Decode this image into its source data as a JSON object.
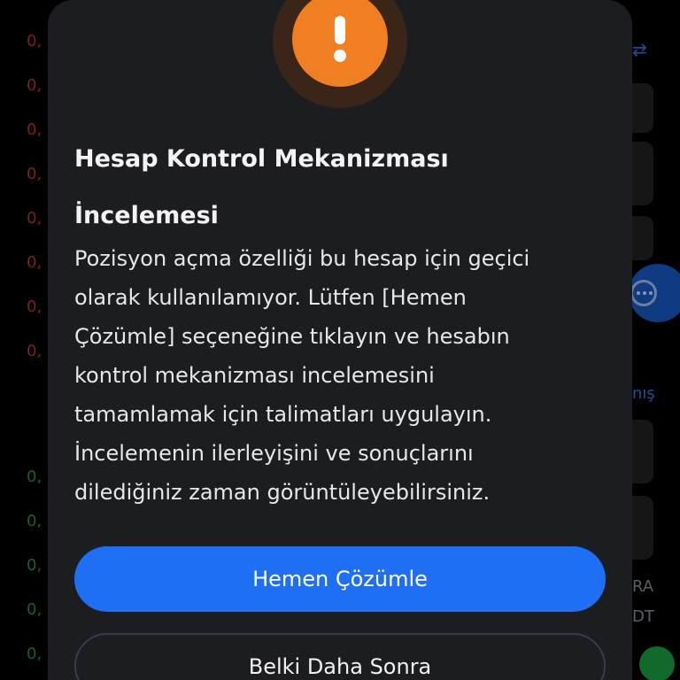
{
  "background": {
    "left_rows_red": [
      "0,",
      "0,",
      "0,",
      "0,",
      "0,",
      "0,",
      "0,",
      "0,"
    ],
    "left_rows_green": [
      "0,",
      "0,",
      "0,",
      "0,",
      "0,"
    ],
    "right_link": "nış",
    "right_text_1": "RA",
    "right_text_2": "DT",
    "colors": {
      "red": "#7a2020",
      "green": "#1c5c34"
    }
  },
  "modal": {
    "icon": "exclamation-icon",
    "icon_color": "#f07f24",
    "title_lines": [
      "Hesap Kontrol Mekanizması",
      "İncelemesi"
    ],
    "body_lines": [
      "Pozisyon açma özelliği bu hesap için geçici",
      "olarak kullanılamıyor. Lütfen [Hemen",
      "Çözümle] seçeneğine tıklayın ve hesabın",
      "kontrol mekanizması incelemesini",
      "tamamlamak için talimatları uygulayın.",
      "İncelemenin ilerleyişini ve sonuçlarını",
      "dilediğiniz zaman görüntüleyebilirsiniz."
    ],
    "primary_button": "Hemen Çözümle",
    "secondary_button": "Belki Daha Sonra",
    "accent_color": "#1f6ff5"
  }
}
